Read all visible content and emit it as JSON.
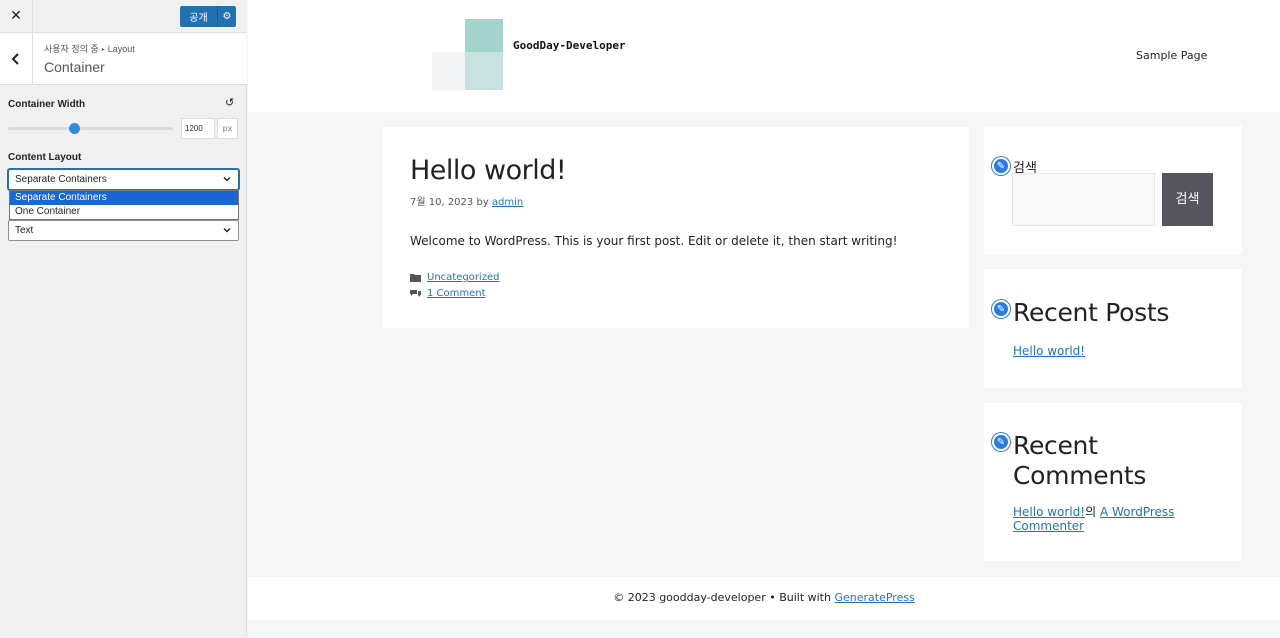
{
  "customizer": {
    "close_icon": "close-icon",
    "publish_label": "공개",
    "settings_icon": "gear-icon",
    "breadcrumb_root": "사용자 정의 중",
    "breadcrumb_parent": "Layout",
    "section_title": "Container",
    "container_width_label": "Container Width",
    "container_width_value": "1200",
    "container_width_unit": "px",
    "container_width_slider_fraction": 0.4,
    "content_layout_label": "Content Layout",
    "content_layout_selected": "Separate Containers",
    "content_layout_options": [
      "Separate Containers",
      "One Container"
    ],
    "second_select_value": "Text"
  },
  "site": {
    "title": "GoodDay-Developer",
    "nav": [
      "Sample Page"
    ],
    "post": {
      "title": "Hello world!",
      "date": "7월 10, 2023",
      "by": "by",
      "author": "admin",
      "body": "Welcome to WordPress. This is your first post. Edit or delete it, then start writing!",
      "category": "Uncategorized",
      "comments": "1 Comment"
    },
    "widgets": {
      "search_title": "검색",
      "search_button": "검색",
      "recent_posts_title": "Recent Posts",
      "recent_posts": [
        "Hello world!"
      ],
      "recent_comments_title": "Recent Comments",
      "comment_post": "Hello world!",
      "comment_joiner": "의",
      "comment_author": "A WordPress Commenter"
    },
    "footer": {
      "text": "© 2023 goodday-developer • Built with",
      "link": "GeneratePress"
    }
  },
  "colors": {
    "accent": "#2271b1",
    "link": "#1e73be",
    "logo_teal": "#a3d4cd"
  }
}
